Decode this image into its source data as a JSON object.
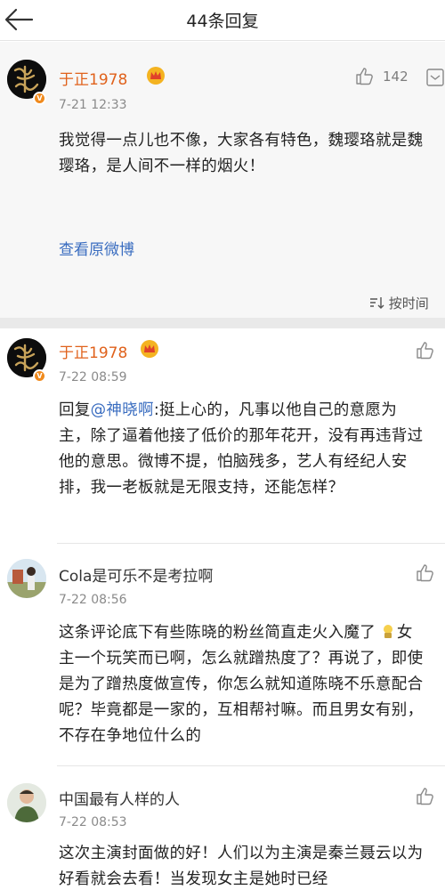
{
  "header": {
    "title": "44条回复"
  },
  "top_comment": {
    "username": "于正1978",
    "time": "7-21 12:33",
    "like_count": "142",
    "content": "我觉得一点儿也不像，大家各有特色，魏璎珞就是魏璎珞，是人间不一样的烟火！",
    "view_original_label": "查看原微博",
    "sort_label": "按时间"
  },
  "replies": [
    {
      "username": "于正1978",
      "time": "7-22 08:59",
      "prefix": "回复",
      "mention": "@神晓啊",
      "content": ":挺上心的，凡事以他自己的意愿为主，除了逼着他接了低价的那年花开，没有再违背过他的意思。微博不提，怕脑残多，艺人有经纪人安排，我一老板就是无限支持，还能怎样？"
    },
    {
      "username": "Cola是可乐不是考拉啊",
      "time": "7-22 08:56",
      "content_line1": "这条评论底下有些陈晓的粉丝简直走火入魔了",
      "content_rest": "女主一个玩笑而已啊，怎么就蹭热度了？再说了，即使是为了蹭热度做宣传，你怎么就知道陈晓不乐意配合呢？毕竟都是一家的，互相帮衬嘛。而且男女有别，不存在争地位什么的"
    },
    {
      "username": "中国最有人样的人",
      "time": "7-22 08:53",
      "content": "这次主演封面做的好！人们以为主演是秦兰聂云以为好看就会去看！当发现女主是她时已经"
    }
  ],
  "colors": {
    "username": "#e0621c",
    "mention": "#3a6dc0",
    "vip": "#f08a1d"
  }
}
